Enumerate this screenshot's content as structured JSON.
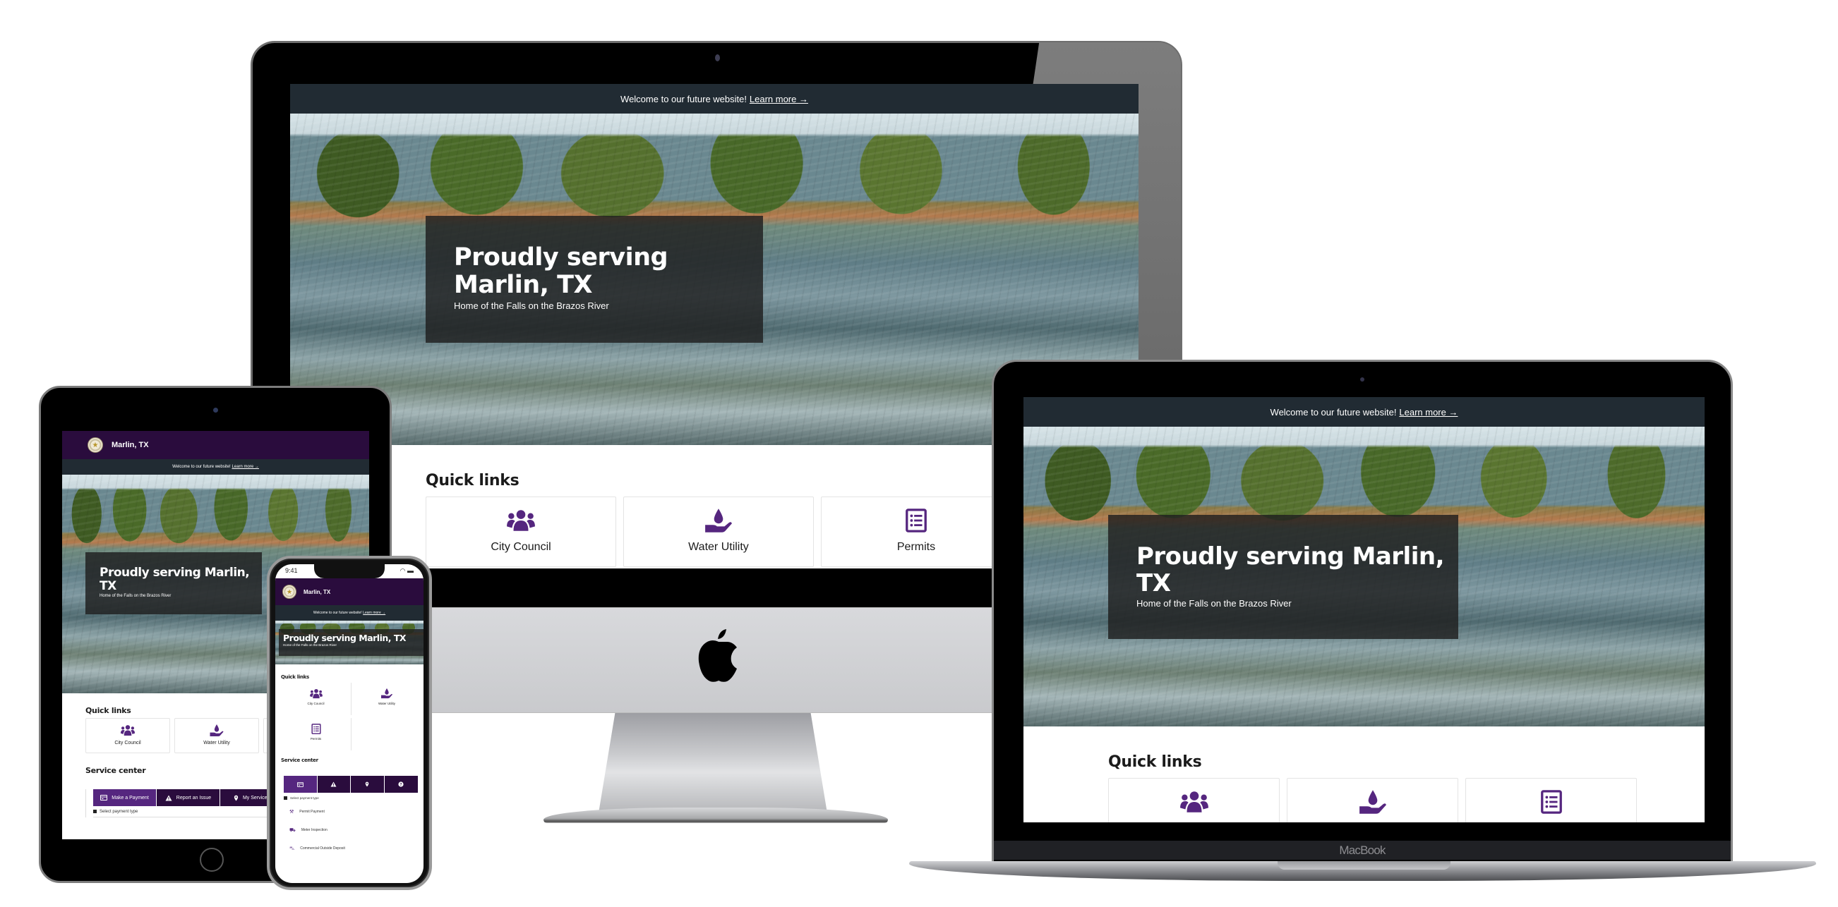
{
  "site": {
    "city_name": "Marlin, TX",
    "banner_text": "Welcome to our future website!",
    "banner_link": "Learn more →",
    "hero_title": "Proudly serving Marlin, TX",
    "hero_title_line1": "Proudly serving",
    "hero_title_line2": "Marlin, TX",
    "hero_title_mb_line1": "Proudly serving Marlin,",
    "hero_title_mb_line2": "TX",
    "hero_subtitle": "Home of the Falls on the Brazos River",
    "quick_links_title": "Quick links",
    "quick_links": [
      {
        "label": "City Council",
        "icon": "users-icon"
      },
      {
        "label": "Water Utility",
        "icon": "hand-water-drop-icon"
      },
      {
        "label": "Permits",
        "icon": "list-icon"
      }
    ],
    "service_center_title": "Service center",
    "service_tabs": [
      {
        "label": "Make a Payment",
        "icon": "credit-card-icon",
        "active": true
      },
      {
        "label": "Report an Issue",
        "icon": "warning-icon",
        "active": false
      },
      {
        "label": "My Services",
        "icon": "map-pin-icon",
        "active": false
      },
      {
        "label": "",
        "icon": "help-icon",
        "active": false
      }
    ],
    "select_payment_label": "Select payment type",
    "payment_types": [
      {
        "label": "Permit Payment",
        "icon": "hammer-icon"
      },
      {
        "label": "Meter Inspection",
        "icon": "meter-icon"
      },
      {
        "label": "Commercial Outside Deposit",
        "icon": "deposit-icon"
      }
    ]
  },
  "devices": {
    "phone_time": "9:41",
    "macbook_label": "MacBook"
  },
  "colors": {
    "brand_purple": "#55267f",
    "nav_dark_purple": "#2a0c3d",
    "banner_dark": "#212b33"
  }
}
